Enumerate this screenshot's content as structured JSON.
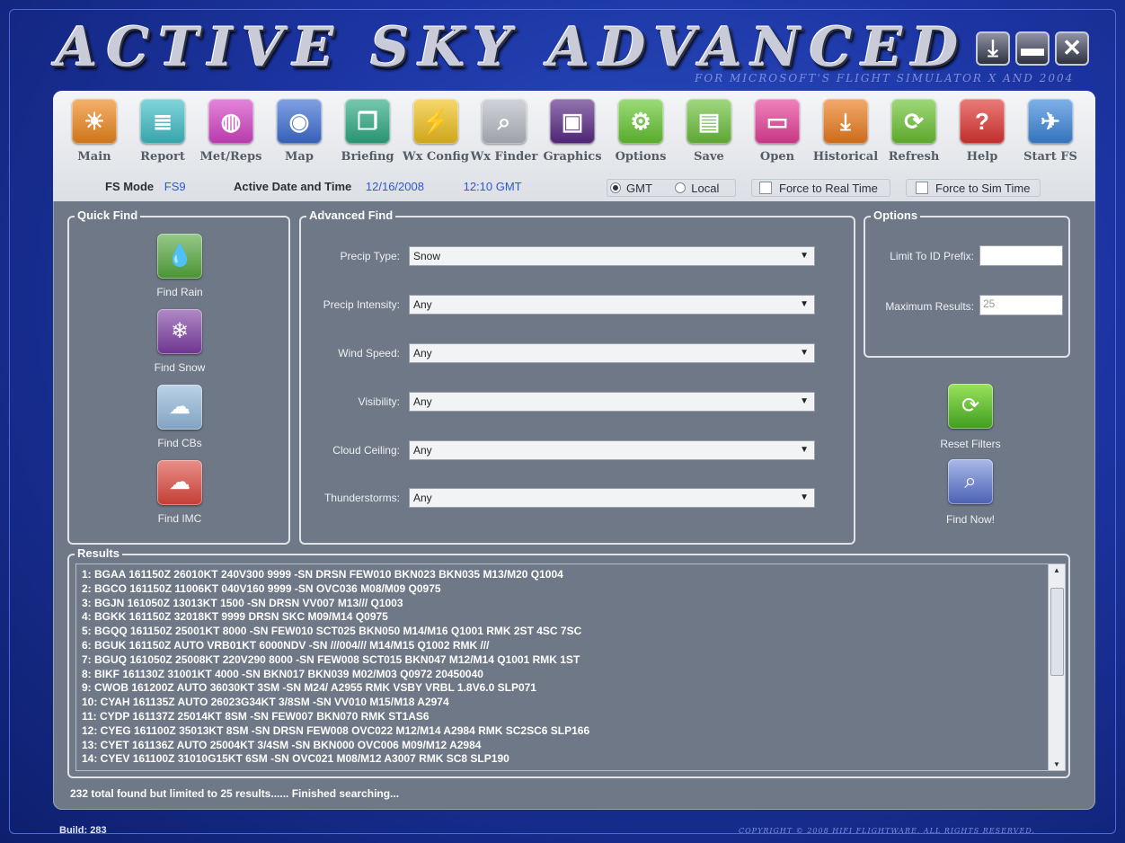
{
  "app": {
    "title": "ACTIVE SKY ADVANCED",
    "subtitle": "FOR MICROSOFT'S FLIGHT SIMULATOR X AND 2004",
    "window_buttons": {
      "download": "⤓",
      "minimize": "▬",
      "close": "✕"
    }
  },
  "toolbar": {
    "items": [
      {
        "label": "Main",
        "icon": "sun-icon",
        "glyph": "☀",
        "color": "#f0881c"
      },
      {
        "label": "Report",
        "icon": "document-icon",
        "glyph": "≣",
        "color": "#3fc0c8"
      },
      {
        "label": "Met/Reps",
        "icon": "globe-icon",
        "glyph": "◍",
        "color": "#d644c8"
      },
      {
        "label": "Map",
        "icon": "earth-icon",
        "glyph": "◉",
        "color": "#3e6fd6"
      },
      {
        "label": "Briefing",
        "icon": "layers-icon",
        "glyph": "❐",
        "color": "#2eab84"
      },
      {
        "label": "Wx Config",
        "icon": "lightning-icon",
        "glyph": "⚡",
        "color": "#f2c21d"
      },
      {
        "label": "Wx Finder",
        "icon": "magnifier-icon",
        "glyph": "⌕",
        "color": "#b9bdc6"
      },
      {
        "label": "Graphics",
        "icon": "monitor-icon",
        "glyph": "▣",
        "color": "#5a2a86"
      },
      {
        "label": "Options",
        "icon": "gears-icon",
        "glyph": "⚙",
        "color": "#67c832"
      },
      {
        "label": "Save",
        "icon": "floppy-icon",
        "glyph": "▤",
        "color": "#6ec23d"
      },
      {
        "label": "Open",
        "icon": "folder-icon",
        "glyph": "▭",
        "color": "#e8409a"
      },
      {
        "label": "Historical",
        "icon": "historical-icon",
        "glyph": "⤓",
        "color": "#ee7d1e"
      },
      {
        "label": "Refresh",
        "icon": "refresh-icon",
        "glyph": "⟳",
        "color": "#6cc433"
      },
      {
        "label": "Help",
        "icon": "help-icon",
        "glyph": "?",
        "color": "#e03531"
      },
      {
        "label": "Start FS",
        "icon": "airplane-icon",
        "glyph": "✈",
        "color": "#3b87dc"
      }
    ]
  },
  "status_bar": {
    "fs_mode_label": "FS Mode",
    "fs_mode_value": "FS9",
    "active_label": "Active Date and Time",
    "date": "12/16/2008",
    "time": "12:10 GMT",
    "gmt_label": "GMT",
    "local_label": "Local",
    "force_real_label": "Force to Real Time",
    "force_sim_label": "Force to Sim Time"
  },
  "quick_find": {
    "title": "Quick Find",
    "items": [
      {
        "label": "Find Rain",
        "icon": "rain-icon",
        "glyph": "💧",
        "color": "#52a43a"
      },
      {
        "label": "Find Snow",
        "icon": "snowflake-icon",
        "glyph": "❄",
        "color": "#7b3ba0"
      },
      {
        "label": "Find CBs",
        "icon": "cloud-icon",
        "glyph": "☁",
        "color": "#8fb4d8"
      },
      {
        "label": "Find IMC",
        "icon": "fog-icon",
        "glyph": "☁",
        "color": "#d9453a"
      }
    ]
  },
  "advanced_find": {
    "title": "Advanced Find",
    "fields": [
      {
        "label": "Precip Type:",
        "value": "Snow"
      },
      {
        "label": "Precip Intensity:",
        "value": "Any"
      },
      {
        "label": "Wind Speed:",
        "value": "Any"
      },
      {
        "label": "Visibility:",
        "value": "Any"
      },
      {
        "label": "Cloud Ceiling:",
        "value": "Any"
      },
      {
        "label": "Thunderstorms:",
        "value": "Any"
      }
    ]
  },
  "options": {
    "title": "Options",
    "limit_label": "Limit To ID Prefix:",
    "limit_value": "",
    "max_label": "Maximum Results:",
    "max_value": "25"
  },
  "actions": {
    "reset_label": "Reset Filters",
    "find_label": "Find Now!"
  },
  "results": {
    "title": "Results",
    "rows": [
      "1: BGAA 161150Z 26010KT 240V300 9999 -SN DRSN FEW010 BKN023 BKN035 M13/M20 Q1004",
      "2: BGCO 161150Z 11006KT 040V160 9999 -SN OVC036 M08/M09 Q0975",
      "3: BGJN 161050Z 13013KT 1500 -SN DRSN VV007 M13/// Q1003",
      "4: BGKK 161150Z 32018KT 9999 DRSN SKC M09/M14 Q0975",
      "5: BGQQ 161150Z 25001KT 8000 -SN FEW010 SCT025 BKN050 M14/M16 Q1001 RMK 2ST 4SC 7SC",
      "6: BGUK 161150Z AUTO VRB01KT 6000NDV -SN ///004/// M14/M15 Q1002 RMK ///",
      "7: BGUQ 161050Z 25008KT 220V290 8000 -SN FEW008 SCT015 BKN047 M12/M14 Q1001 RMK 1ST",
      "8: BIKF 161130Z 31001KT 4000 -SN BKN017 BKN039 M02/M03 Q0972 20450040",
      "9: CWOB 161200Z AUTO 36030KT 3SM -SN M24/ A2955 RMK VSBY VRBL 1.8V6.0 SLP071",
      "10: CYAH 161135Z AUTO 26023G34KT 3/8SM -SN VV010 M15/M18 A2974",
      "11: CYDP 161137Z 25014KT 8SM -SN FEW007 BKN070 RMK ST1AS6",
      "12: CYEG 161100Z 35013KT 8SM -SN DRSN FEW008 OVC022 M12/M14 A2984 RMK SC2SC6 SLP166",
      "13: CYET 161136Z AUTO 25004KT 3/4SM -SN BKN000 OVC006 M09/M12 A2984",
      "14: CYEV 161100Z 31010G15KT 6SM -SN OVC021 M08/M12 A3007 RMK SC8 SLP190"
    ]
  },
  "status_message": "232 total found but limited to 25 results...... Finished searching...",
  "footer": {
    "build": "Build: 283",
    "copyright": "COPYRIGHT © 2008 HIFI FLIGHTWARE. ALL RIGHTS RESERVED."
  }
}
